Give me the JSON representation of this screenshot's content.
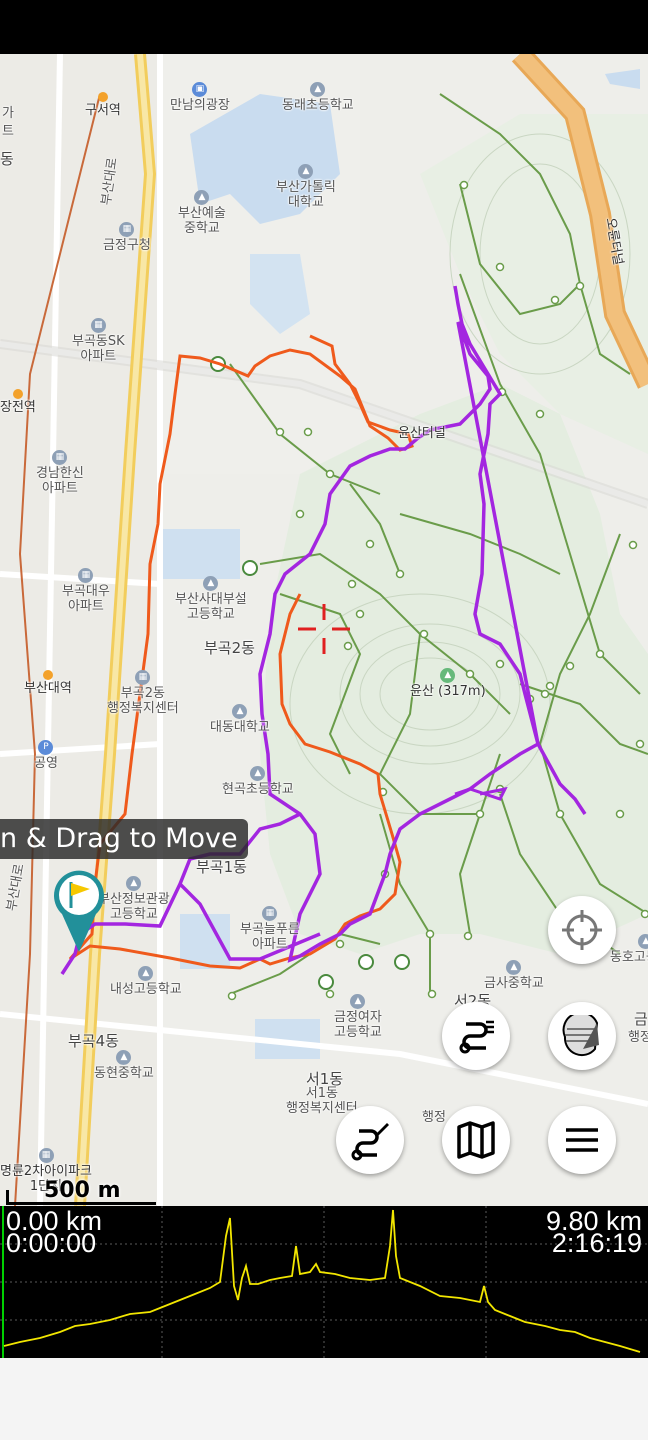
{
  "map": {
    "labels": {
      "gusuyeok": "구서역",
      "mannamui_gwangjang": "만남의광장",
      "dongnae_elem": "동래초등학교",
      "busan_catholic": "부산가톨릭",
      "busan_catholic2": "대학교",
      "busan_arts": "부산예술",
      "busan_arts2": "중학교",
      "geumjeong_gu": "금정구청",
      "bugok_sk": "부곡동SK",
      "bugok_sk2": "아파트",
      "jangjeon_station": "장전역",
      "gyeongnam_hanshin": "경남한신",
      "gyeongnam_hanshin2": "아파트",
      "bugok_daewoo": "부곡대우",
      "bugok_daewoo2": "아파트",
      "busan_univ_station": "부산대역",
      "gongyeong": "공영",
      "busan_sadae_hs": "부산사대부설",
      "busan_sadae_hs2": "고등학교",
      "bugok2dong": "부곡2동",
      "bugok2_welfare": "부곡2동",
      "bugok2_welfare2": "행정복지센터",
      "daedong_univ": "대동대학교",
      "hyeongok_elem": "현곡초등학교",
      "bugok1dong": "부곡1동",
      "busan_info_hs": "부산정보관광",
      "busan_info_hs2": "고등학교",
      "bugok_neulpureun": "부곡늘푸른",
      "bugok_neulpureun2": "아파트",
      "naeseong_hs": "내성고등학교",
      "bugok4dong": "부곡4동",
      "donghyeon_mid": "동현중학교",
      "myeongryun": "명륜2차아이파크",
      "myeongryun2": "1단지",
      "seo1dong": "서1동",
      "seo1_welfare": "서1동",
      "seo1_welfare2": "행정복지센터",
      "geumjeong_girls": "금정여자",
      "geumjeong_girls2": "고등학교",
      "geumsa_mid": "금사중학교",
      "seo2dong": "서2동",
      "yunsan_tunnel": "윤산터널",
      "yunsan_peak": "윤산 (317m)",
      "oryun_tunnel": "오륜터널",
      "dongho_hs": "동호고등학교",
      "left_edge_1": "가",
      "left_edge_2": "트",
      "left_edge_3": "동",
      "right_edge_1": "금",
      "right_edge_2": "행정",
      "haeng": "행정",
      "road_busan_ro": "부산대로",
      "road_busan_ro2": "부산대로"
    },
    "tooltip": "n & Drag to Move",
    "scale_label": "500 m"
  },
  "controls": {
    "locate_icon": "crosshair-icon",
    "layer_icon": "layers-icon",
    "route_list_icon": "route-list-icon",
    "draw_route_icon": "draw-route-icon",
    "map_icon": "map-icon",
    "menu_icon": "hamburger-menu-icon"
  },
  "elevation": {
    "start_distance": "0.00 km",
    "start_time": "0:00:00",
    "end_distance": "9.80 km",
    "end_time": "2:16:19",
    "profile_color": "#f2e600"
  },
  "colors": {
    "route_purple": "#a326e0",
    "route_orange": "#ef5a1c",
    "trail_green": "#5d8f3e",
    "road_yellow": "#f2cd5c",
    "pin_teal": "#22909a",
    "pin_flag": "#f6c800"
  }
}
